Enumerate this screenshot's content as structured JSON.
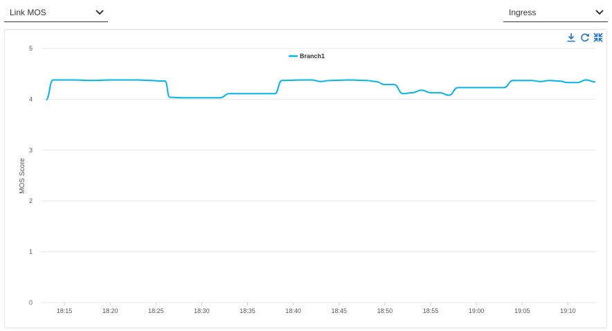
{
  "toolbar": {
    "metric_select": {
      "value": "Link MOS"
    },
    "direction_select": {
      "value": "Ingress"
    }
  },
  "chart_actions": [
    "download-icon",
    "refresh-icon",
    "collapse-icon"
  ],
  "colors": {
    "series": "#00b5e8",
    "icon": "#1a73c9",
    "grid": "#e4e4e4"
  },
  "chart_data": {
    "type": "line",
    "title": "",
    "xlabel": "",
    "ylabel": "MOS Score",
    "ylim": [
      0,
      5
    ],
    "yticks": [
      0,
      1,
      2,
      3,
      4,
      5
    ],
    "xlim": [
      "18:12:30",
      "19:13"
    ],
    "xticks": [
      "18:15",
      "18:20",
      "18:25",
      "18:30",
      "18:35",
      "18:40",
      "18:45",
      "18:50",
      "18:55",
      "19:00",
      "19:05",
      "19:10"
    ],
    "grid": true,
    "legend": "top-center",
    "series": [
      {
        "name": "Branch1",
        "points": [
          [
            "18:13",
            3.99
          ],
          [
            "18:13:45",
            4.38
          ],
          [
            "18:16",
            4.38
          ],
          [
            "18:18",
            4.37
          ],
          [
            "18:20",
            4.38
          ],
          [
            "18:23",
            4.38
          ],
          [
            "18:24:30",
            4.37
          ],
          [
            "18:25:30",
            4.36
          ],
          [
            "18:26",
            4.36
          ],
          [
            "18:26:30",
            4.04
          ],
          [
            "18:28",
            4.03
          ],
          [
            "18:32",
            4.03
          ],
          [
            "18:33",
            4.11
          ],
          [
            "18:38",
            4.11
          ],
          [
            "18:38:45",
            4.37
          ],
          [
            "18:41",
            4.38
          ],
          [
            "18:42",
            4.38
          ],
          [
            "18:43",
            4.35
          ],
          [
            "18:44",
            4.37
          ],
          [
            "18:46",
            4.38
          ],
          [
            "18:48",
            4.37
          ],
          [
            "18:49",
            4.35
          ],
          [
            "18:50",
            4.29
          ],
          [
            "18:51",
            4.29
          ],
          [
            "18:52",
            4.11
          ],
          [
            "18:53",
            4.13
          ],
          [
            "18:54",
            4.18
          ],
          [
            "18:55",
            4.13
          ],
          [
            "18:56",
            4.13
          ],
          [
            "18:57",
            4.08
          ],
          [
            "18:58",
            4.23
          ],
          [
            "19:01",
            4.23
          ],
          [
            "19:03",
            4.23
          ],
          [
            "19:04",
            4.37
          ],
          [
            "19:06",
            4.37
          ],
          [
            "19:07",
            4.35
          ],
          [
            "19:08",
            4.37
          ],
          [
            "19:09",
            4.36
          ],
          [
            "19:10",
            4.33
          ],
          [
            "19:11",
            4.33
          ],
          [
            "19:12",
            4.38
          ],
          [
            "19:13",
            4.34
          ]
        ]
      }
    ]
  }
}
